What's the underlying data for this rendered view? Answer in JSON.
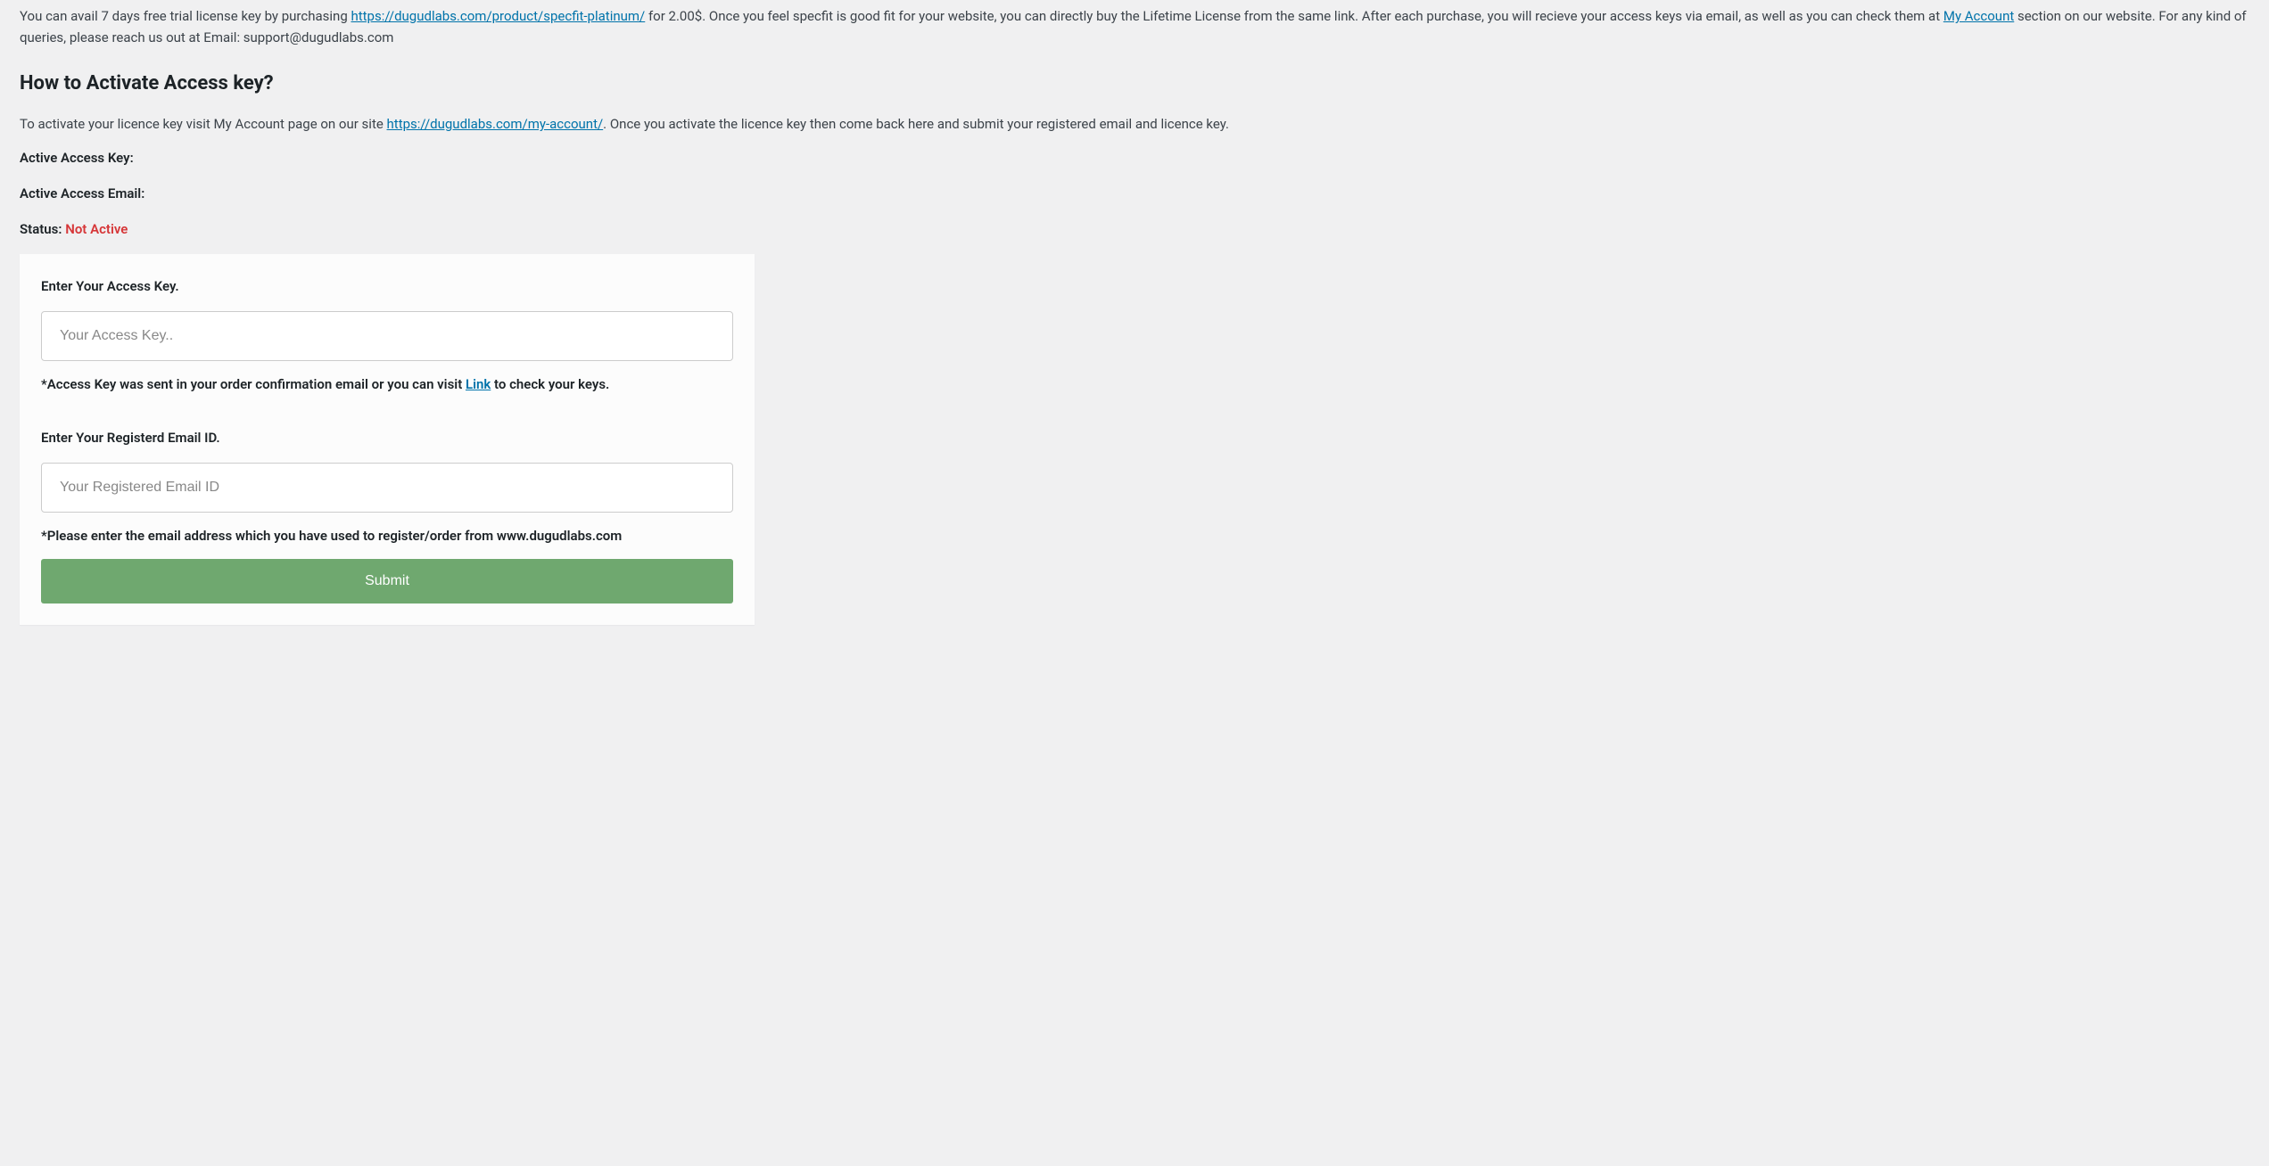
{
  "intro": {
    "part1": "You can avail 7 days free trial license key by purchasing ",
    "link1_text": "https://dugudlabs.com/product/specfit-platinum/",
    "part2": " for 2.00$. Once you feel specfit is good fit for your website, you can directly buy the Lifetime License from the same link. After each purchase, you will recieve your access keys via email, as well as you can check them at ",
    "link2_text": "My Account",
    "part3": " section on our website. For any kind of queries, please reach us out at Email: support@dugudlabs.com"
  },
  "heading": "How to Activate Access key?",
  "activate_text": {
    "part1": "To activate your licence key visit My Account page on our site ",
    "link_text": "https://dugudlabs.com/my-account/",
    "part2": ". Once you activate the licence key then come back here and submit your registered email and licence key."
  },
  "status_lines": {
    "access_key_label": "Active Access Key:",
    "access_email_label": "Active Access Email:",
    "status_label": "Status: ",
    "status_value": "Not Active"
  },
  "form": {
    "access_key_label": "Enter Your Access Key.",
    "access_key_placeholder": "Your Access Key..",
    "access_key_helper_part1": "*Access Key was sent in your order confirmation email or you can visit ",
    "access_key_helper_link": "Link",
    "access_key_helper_part2": " to check your keys.",
    "email_label": "Enter Your Registerd Email ID.",
    "email_placeholder": "Your Registered Email ID",
    "email_helper": "*Please enter the email address which you have used to register/order from www.dugudlabs.com",
    "submit_label": "Submit"
  }
}
